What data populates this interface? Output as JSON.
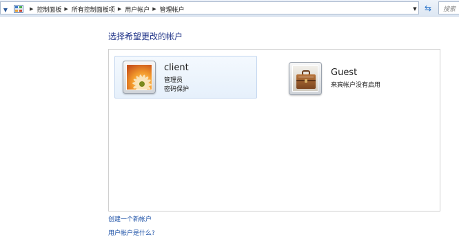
{
  "address_bar": {
    "breadcrumbs": [
      "控制面板",
      "所有控制面板项",
      "用户帐户",
      "管理帐户"
    ],
    "search_placeholder": "搜索"
  },
  "page": {
    "heading": "选择希望更改的帐户"
  },
  "accounts": [
    {
      "name": "client",
      "lines": [
        "管理员",
        "密码保护"
      ],
      "icon": "flower-avatar-icon",
      "selected": true
    },
    {
      "name": "Guest",
      "lines": [
        "来宾帐户没有启用"
      ],
      "icon": "briefcase-avatar-icon",
      "selected": false
    }
  ],
  "links": {
    "create_account": "创建一个新帐户",
    "what_is_account": "用户帐户是什么?"
  },
  "colors": {
    "heading": "#1e3287",
    "link": "#1a4fa6",
    "selection_bg": "#e6f0fb",
    "selection_border": "#c3d6ef"
  }
}
